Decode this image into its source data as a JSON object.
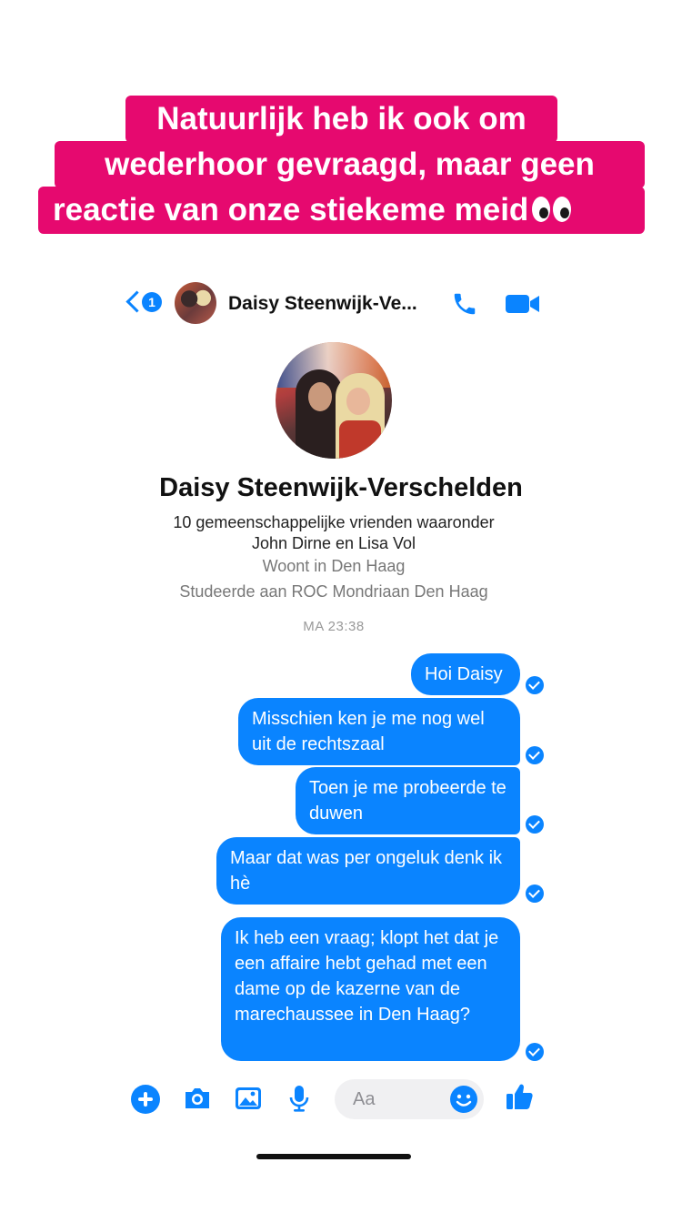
{
  "caption": {
    "line1": "Natuurlijk heb ik ook om",
    "line2": "wederhoor gevraagd, maar geen",
    "line3": "reactie van onze stiekeme meid",
    "emoji": "eyes-emoji"
  },
  "header": {
    "back_badge": "1",
    "contact_name": "Daisy Steenwijk-Ve...",
    "icons": [
      "back-chevron-icon",
      "phone-icon",
      "video-camera-icon"
    ]
  },
  "profile": {
    "name": "Daisy Steenwijk-Verschelden",
    "mutual_line1": "10 gemeenschappelijke vrienden waaronder",
    "mutual_line2": "John Dirne en Lisa Vol",
    "lives": "Woont in Den Haag",
    "studied": "Studeerde aan ROC Mondriaan Den Haag"
  },
  "conversation": {
    "timestamp": "MA 23:38",
    "messages": [
      {
        "text": "Hoi Daisy",
        "status": "sent"
      },
      {
        "text": "Misschien ken je me nog wel uit de rechtszaal",
        "status": "sent"
      },
      {
        "text": "Toen je me probeerde te duwen",
        "status": "sent"
      },
      {
        "text": "Maar dat was per ongeluk denk ik hè",
        "status": "sent"
      },
      {
        "text": "Ik heb een vraag; klopt het dat je een affaire hebt gehad met een dame op de kazerne van de marechaussee in Den Haag?",
        "status": "sent"
      }
    ]
  },
  "composer": {
    "placeholder": "Aa",
    "icons": [
      "plus-icon",
      "camera-icon",
      "photo-icon",
      "microphone-icon",
      "emoji-icon",
      "like-icon"
    ]
  },
  "colors": {
    "caption_bg": "#e6096f",
    "messenger_blue": "#0a84ff"
  }
}
